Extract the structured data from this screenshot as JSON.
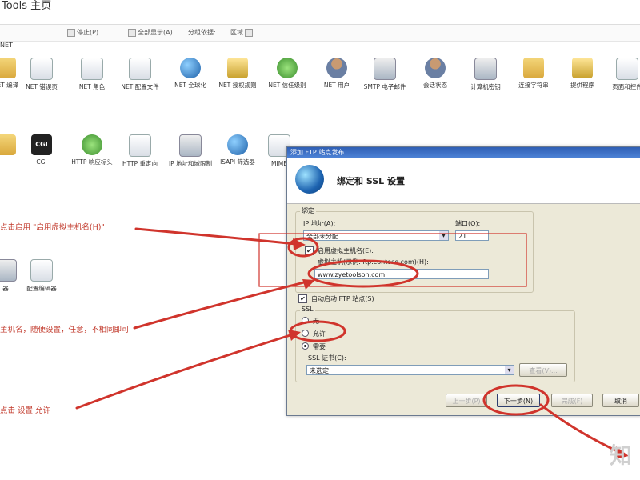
{
  "window": {
    "title": "Tools 主页"
  },
  "toolbar": {
    "items": [
      "停止(P)",
      "全部显示(A)",
      "分组依据:",
      "区域"
    ]
  },
  "section": {
    "label": "NET"
  },
  "icons_row1": [
    {
      "label": "NET 编译",
      "icon": "folder-icon"
    },
    {
      "label": "NET 错误页",
      "icon": "warning-page-icon"
    },
    {
      "label": "NET 角色",
      "icon": "roles-icon"
    },
    {
      "label": "NET 配置文件",
      "icon": "profile-doc-icon"
    },
    {
      "label": "NET 全球化",
      "icon": "globe-icon"
    },
    {
      "label": "NET 授权规则",
      "icon": "authorization-icon"
    },
    {
      "label": "NET 信任级别",
      "icon": "trust-icon"
    },
    {
      "label": "NET 用户",
      "icon": "users-icon"
    },
    {
      "label": "SMTP 电子邮件",
      "icon": "email-icon"
    },
    {
      "label": "会话状态",
      "icon": "session-icon"
    },
    {
      "label": "计算机密钥",
      "icon": "machine-key-icon"
    },
    {
      "label": "连接字符串",
      "icon": "connection-string-icon"
    },
    {
      "label": "提供程序",
      "icon": "providers-icon"
    },
    {
      "label": "页面和控件",
      "icon": "pages-controls-icon"
    }
  ],
  "icons_row2": [
    {
      "label": "",
      "icon": "partial-icon"
    },
    {
      "label": "CGI",
      "icon": "cgi-icon"
    },
    {
      "label": "HTTP 响应标头",
      "icon": "response-headers-icon"
    },
    {
      "label": "HTTP 重定向",
      "icon": "redirect-icon"
    },
    {
      "label": "IP 地址和域限制",
      "icon": "ip-restrictions-icon"
    },
    {
      "label": "ISAPI 筛选器",
      "icon": "isapi-icon"
    },
    {
      "label": "MIME",
      "icon": "mime-icon"
    }
  ],
  "icons_row3": [
    {
      "label": "器",
      "icon": "partial-icon"
    },
    {
      "label": "配置编辑器",
      "icon": "config-editor-icon"
    }
  ],
  "annotations": {
    "note1": "点击启用 \"启用虚拟主机名(H)\"",
    "note2": "主机名，随便设置，任意，不相同即可",
    "note3": "点击 设置 允许"
  },
  "dialog": {
    "caption": "添加 FTP 站点发布",
    "heading": "绑定和 SSL 设置",
    "binding_group": "绑定",
    "ip_label": "IP 地址(A):",
    "ip_value": "全部未分配",
    "port_label": "端口(O):",
    "port_value": "21",
    "enable_vhost_label": "启用虚拟主机名(E):",
    "vhost_label": "虚拟主机(示例: ftp.contoso.com)(H):",
    "vhost_value": "www.zyetoolsoh.com",
    "autostart_label": "自动启动 FTP 站点(S)",
    "ssl_group": "SSL",
    "ssl_none": "无",
    "ssl_allow": "允许",
    "ssl_require": "需要",
    "cert_label": "SSL 证书(C):",
    "cert_value": "未选定",
    "view_button": "查看(V)...",
    "prev_button": "上一步(P)",
    "next_button": "下一步(N)",
    "finish_button": "完成(F)",
    "cancel_button": "取消"
  },
  "watermark": "知",
  "colors": {
    "annotation": "#d0342c",
    "dialog_bg": "#ece9d8",
    "caption": "#2f5fb5"
  }
}
